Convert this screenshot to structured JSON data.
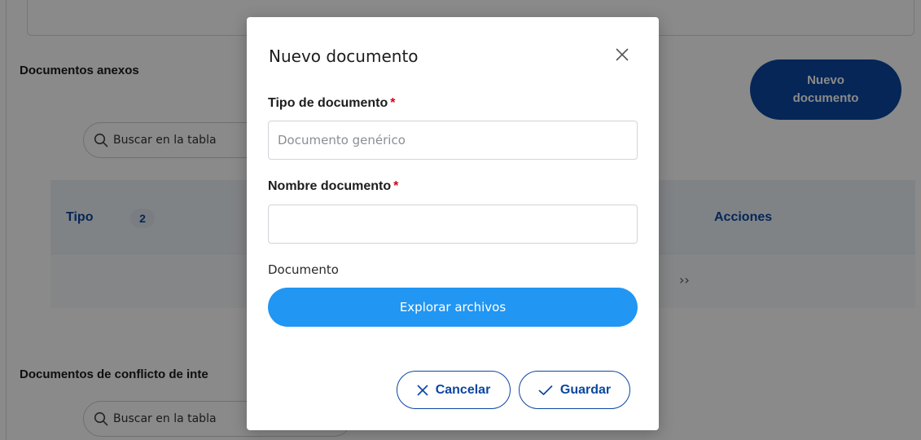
{
  "background": {
    "section_annexes_title": "Documentos anexos",
    "search_placeholder": "Buscar en la tabla",
    "new_document_button_line1": "Nuevo",
    "new_document_button_line2": "documento",
    "table": {
      "col_type": "Tipo",
      "sort_badge": "2",
      "col_actions": "Acciones",
      "pager_next": "››"
    },
    "section_conflict_title": "Documentos de conflicto de inte",
    "search2_placeholder": "Buscar en la tabla"
  },
  "modal": {
    "title": "Nuevo documento",
    "close_icon": "close-icon",
    "type_label": "Tipo de documento",
    "required_mark": "*",
    "type_placeholder": "Documento genérico",
    "name_label": "Nombre documento",
    "name_value": "",
    "document_label": "Documento",
    "browse_button": "Explorar archivos",
    "cancel_button": "Cancelar",
    "save_button": "Guardar"
  },
  "colors": {
    "primary": "#0b47a0",
    "accent": "#2196f3",
    "required": "#d0021b"
  }
}
